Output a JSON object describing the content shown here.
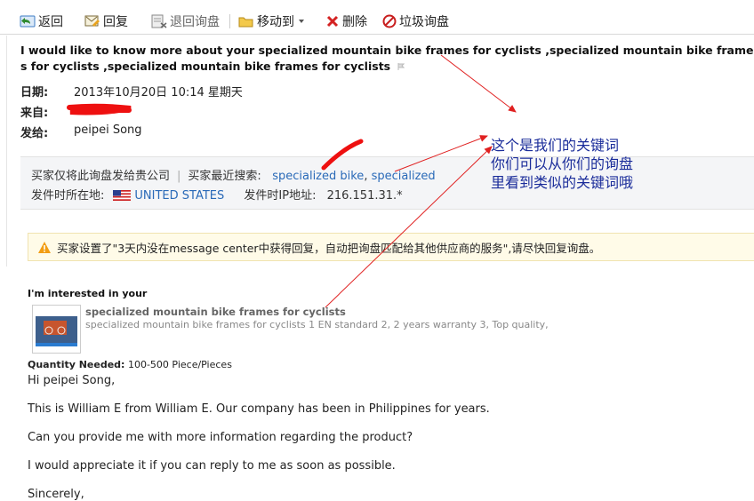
{
  "toolbar": {
    "reply_label": "返回",
    "reply2_label": "回复",
    "back_inquiry_label": "退回询盘",
    "move_label": "移动到",
    "delete_label": "删除",
    "spam_label": "垃圾询盘"
  },
  "mail": {
    "subject": "I would like to know more about your specialized mountain bike frames for cyclists ,specialized mountain bike frames for cyclists ,specialized mountain bike frames for cyclists",
    "date_label": "日期:",
    "date_value": "2013年10月20日  10:14  星期天",
    "from_label": "来自:",
    "to_label": "发给:",
    "to_value": "peipei Song"
  },
  "buyer_info": {
    "notice": "买家仅将此询盘发给贵公司",
    "recent_search_label": "买家最近搜索:",
    "recent_search_1": "specialized bike",
    "recent_search_sep": ",",
    "recent_search_2": "specialized",
    "location_label": "发件时所在地:",
    "country": "UNITED STATES",
    "ip_label": "发件时IP地址:",
    "ip_value": "216.151.31.*"
  },
  "annotation": {
    "line1": "这个是我们的关键词",
    "line2": "你们可以从你们的询盘",
    "line3": "里看到类似的关键词哦"
  },
  "warning": {
    "text": "买家设置了\"3天内没在message center中获得回复，自动把询盘匹配给其他供应商的服务\",请尽快回复询盘。"
  },
  "product": {
    "interested_label": "I'm interested in your",
    "title": "specialized mountain bike frames for cyclists",
    "desc": "specialized mountain bike frames for cyclists 1 EN standard 2, 2 years warranty 3, Top quality,",
    "qty_label": "Quantity Needed:",
    "qty_value": "100-500 Piece/Pieces"
  },
  "message": {
    "greeting": "Hi peipei Song,",
    "p1": "This is William E from William E. Our company has been in Philippines for years.",
    "p2": "Can you provide me with more information regarding the product?",
    "p3": "I would appreciate it if you can reply to me as soon as possible.",
    "closing": "Sincerely,"
  },
  "colors": {
    "link": "#2a6ab8",
    "annotation": "#1a2c9a",
    "arrow": "#e02020",
    "redaction": "#ee1010"
  }
}
